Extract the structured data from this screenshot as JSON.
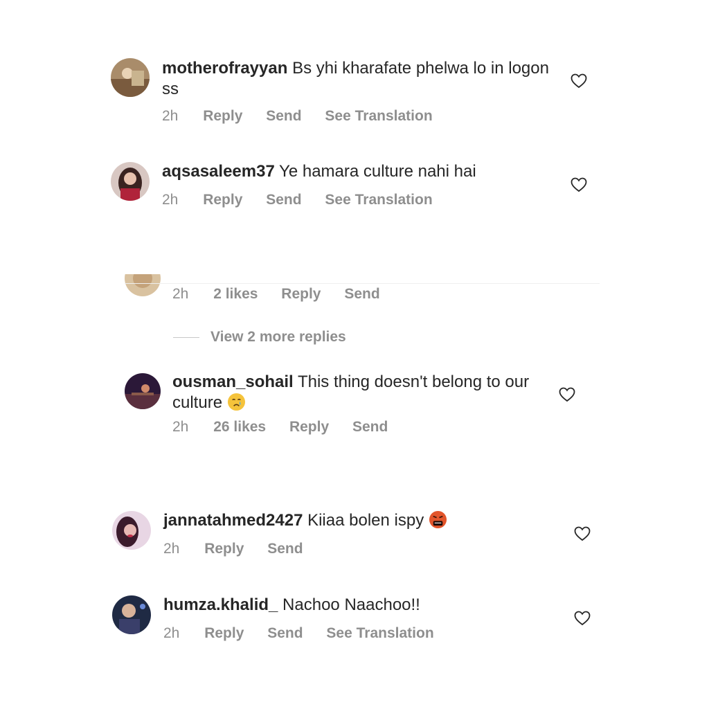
{
  "comments": [
    {
      "username": "motherofrayyan",
      "text": "Bs yhi kharafate phelwa lo in logon ss",
      "time": "2h",
      "actions": [
        "Reply",
        "Send",
        "See Translation"
      ]
    },
    {
      "username": "aqsasaleem37",
      "text": "Ye hamara culture nahi hai",
      "time": "2h",
      "actions": [
        "Reply",
        "Send",
        "See Translation"
      ]
    }
  ],
  "partial_reply": {
    "time": "2h",
    "likes": "2 likes",
    "actions": [
      "Reply",
      "Send"
    ]
  },
  "view_more": "View 2 more replies",
  "reply": {
    "username": "ousman_sohail",
    "text": "This thing doesn't belong to our culture",
    "emoji": "crying-face",
    "time": "2h",
    "likes": "26 likes",
    "actions": [
      "Reply",
      "Send"
    ]
  },
  "comments2": [
    {
      "username": "jannatahmed2427",
      "text": "Kiiaa bolen ispy",
      "emoji": "face-with-symbols-on-mouth",
      "time": "2h",
      "actions": [
        "Reply",
        "Send"
      ]
    },
    {
      "username": "humza.khalid_",
      "text": "Nachoo Naachoo!!",
      "time": "2h",
      "actions": [
        "Reply",
        "Send",
        "See Translation"
      ]
    }
  ],
  "colors": {
    "text": "#262626",
    "meta": "#8e8e8e",
    "emoji_tear": "#f5c33b",
    "emoji_angry": "#e2552b"
  }
}
